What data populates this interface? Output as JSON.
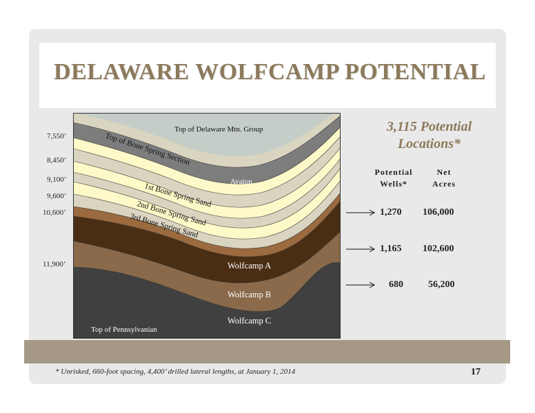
{
  "title": "DELAWARE WOLFCAMP POTENTIAL",
  "headline": {
    "line1": "3,115 Potential",
    "line2": "Locations*"
  },
  "columns": {
    "wells": {
      "line1": "Potential",
      "line2": "Wells*"
    },
    "acres": {
      "line1": "Net",
      "line2": "Acres"
    }
  },
  "rows": [
    {
      "wells": "1,270",
      "acres": "106,000"
    },
    {
      "wells": "1,165",
      "acres": "102,600"
    },
    {
      "wells": "680",
      "acres": "56,200"
    }
  ],
  "depths": [
    "7,550’",
    "8,450’",
    "9,100’",
    "9,600’",
    "10,600’",
    "11,900’"
  ],
  "layers": {
    "top_delaware": "Top of Delaware Mtn. Group",
    "top_bone_spring": "Top of Bone Spring Section",
    "avalon": "Avalon",
    "first_bs": "1st Bone Spring Sand",
    "second_bs": "2nd Bone Spring Sand",
    "third_bs": "3rd Bone Spring Sand",
    "wolfcamp_a": "Wolfcamp A",
    "wolfcamp_b": "Wolfcamp B",
    "wolfcamp_c": "Wolfcamp C",
    "top_penn": "Top of Pennsylvanian"
  },
  "footnote": "* Unrisked, 660-foot spacing, 4,400’ drilled lateral lengths, at January 1, 2014",
  "page_number": "17",
  "colors": {
    "title": "#8c7a5b",
    "band": "#a59985",
    "top_layer": "#c4cdc7",
    "gray": "#7d7d7d",
    "beige": "#d9d5c0",
    "cream": "#fdf9c8",
    "brown_light": "#9b6a3e",
    "brown_dark": "#4a2e14",
    "charcoal": "#404040"
  }
}
